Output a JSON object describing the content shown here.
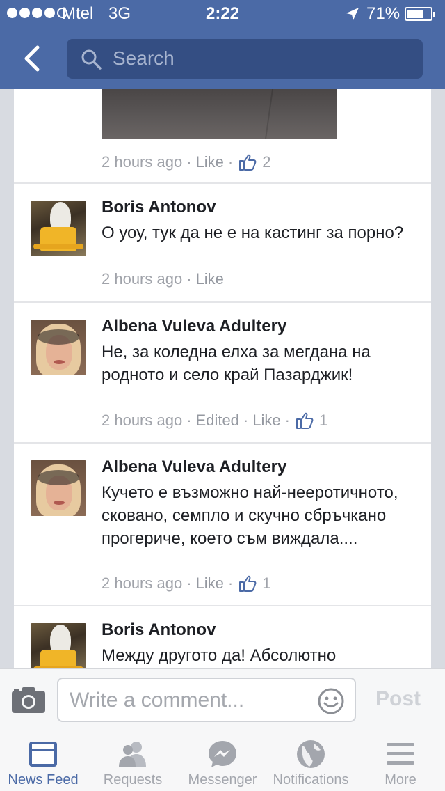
{
  "status_bar": {
    "carrier": "Mtel",
    "network": "3G",
    "time": "2:22",
    "battery": "71%",
    "signal_bars": 4,
    "battery_level": 0.71
  },
  "header": {
    "back_icon": "chevron-left-icon",
    "search_placeholder": "Search"
  },
  "feed": {
    "top_item": {
      "time": "2 hours ago",
      "like_label": "Like",
      "likes": "2"
    },
    "comments": [
      {
        "author": "Boris Antonov",
        "text": "О уоу, тук да не е на кастинг за порно?",
        "time": "2 hours ago",
        "like_label": "Like"
      },
      {
        "author": "Albena Vuleva Adultery",
        "text": "Не, за коледна елха за мегдана на родното и село край Пазарджик!",
        "time": "2 hours ago",
        "edited": "Edited",
        "like_label": "Like",
        "likes": "1"
      },
      {
        "author": "Albena Vuleva Adultery",
        "text": "Кучето е възможно най-нееротичното, сковано, семпло и скучно сбръчкано прогериче, което съм виждала....",
        "time": "2 hours ago",
        "like_label": "Like",
        "likes": "1"
      },
      {
        "author": "Boris Antonov",
        "text": "Между другото да! Абсолютно"
      }
    ]
  },
  "composer": {
    "placeholder": "Write a comment...",
    "post_label": "Post"
  },
  "tabs": [
    {
      "label": "News Feed",
      "icon": "news-feed-icon",
      "active": true
    },
    {
      "label": "Requests",
      "icon": "friends-icon",
      "active": false
    },
    {
      "label": "Messenger",
      "icon": "messenger-icon",
      "active": false
    },
    {
      "label": "Notifications",
      "icon": "globe-icon",
      "active": false
    },
    {
      "label": "More",
      "icon": "menu-icon",
      "active": false
    }
  ],
  "colors": {
    "brand": "#4b6aa6",
    "search_field": "#344e83",
    "meta_text": "#a0a3aa"
  }
}
